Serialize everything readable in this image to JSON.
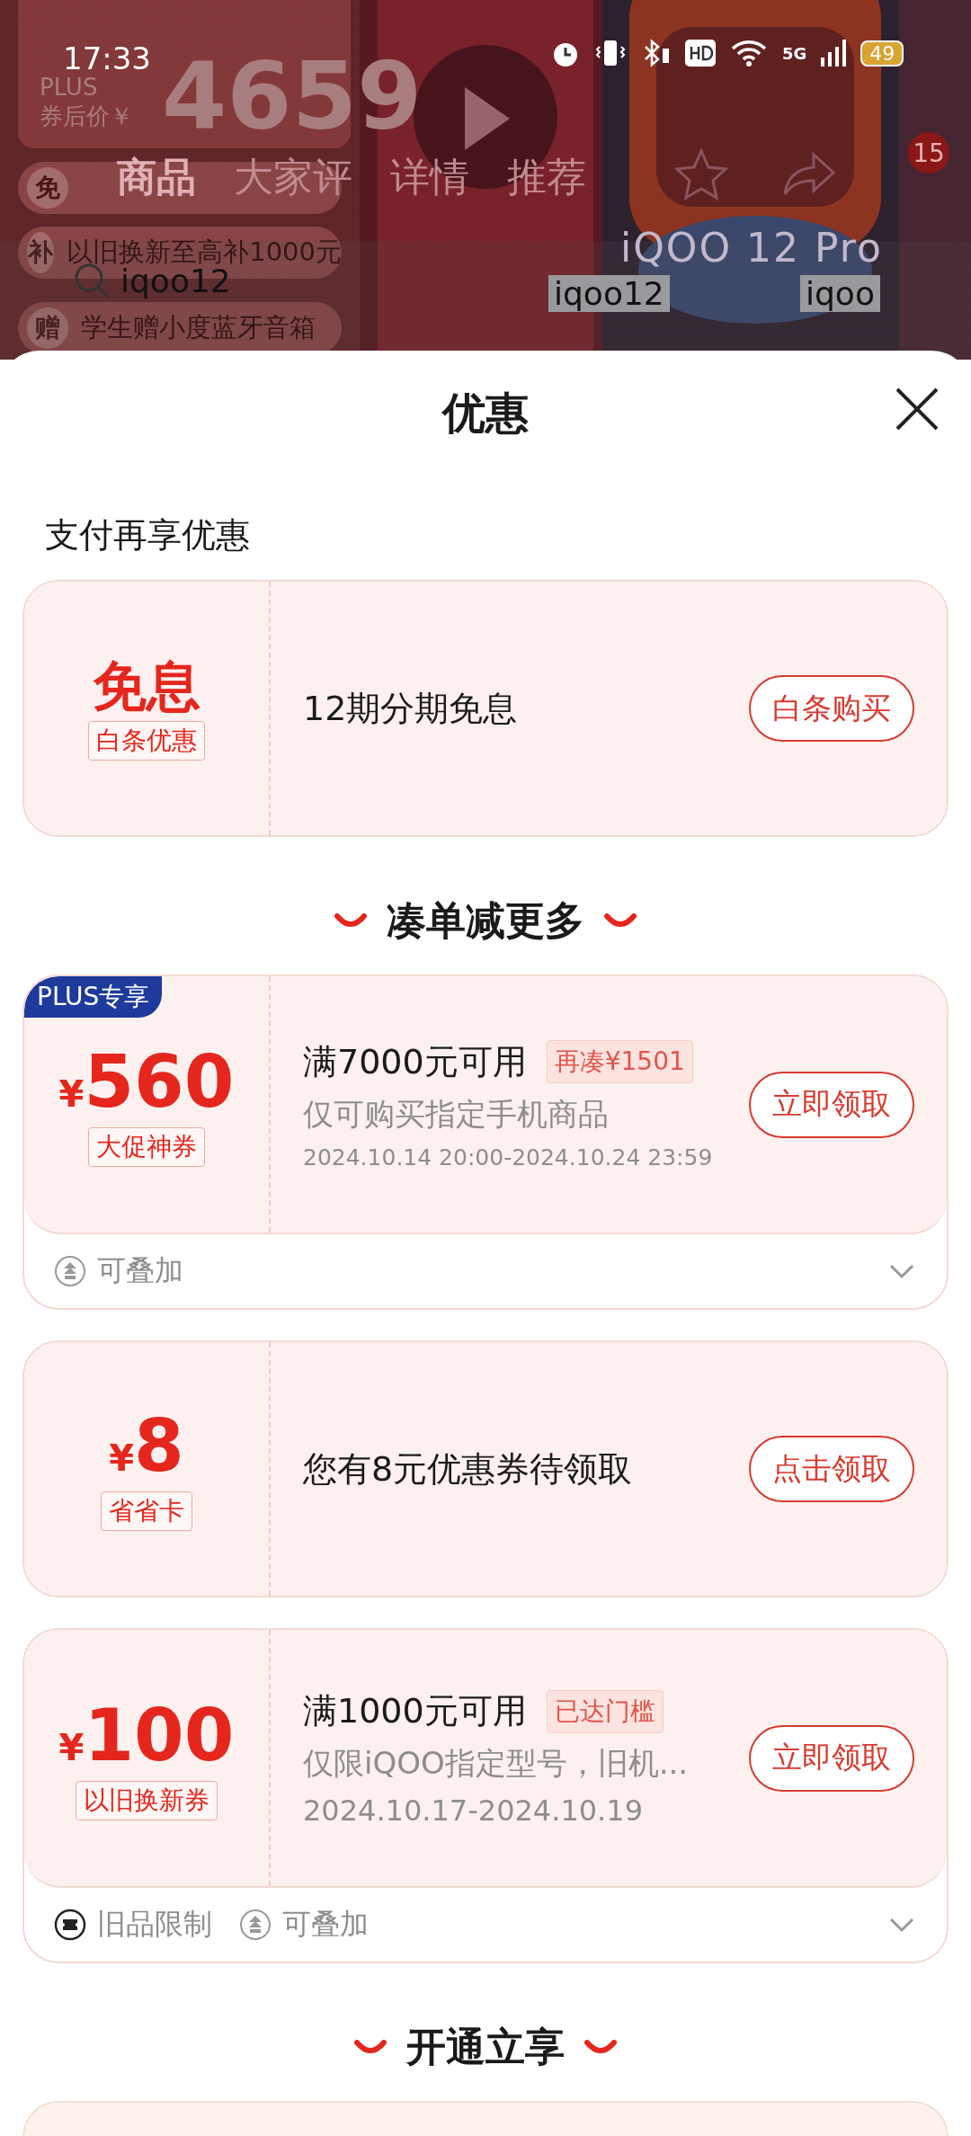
{
  "status_bar": {
    "time": "17:33",
    "network": "5G",
    "battery": "49"
  },
  "background": {
    "plus": "PLUS",
    "price_prefix": "券后价￥",
    "price": "4659",
    "promos": [
      {
        "tag": "免"
      },
      {
        "tag": "补",
        "text": "以旧换新至高补1000元"
      },
      {
        "tag": "赠",
        "text": "学生赠小度蓝牙音箱"
      }
    ],
    "tabs": [
      {
        "label": "商品",
        "selected": true
      },
      {
        "label": "大家评",
        "selected": false
      },
      {
        "label": "详情",
        "selected": false
      },
      {
        "label": "推荐",
        "selected": false
      }
    ],
    "cart_badge": "15",
    "product_name": "iQOO 12 Pro",
    "search": "iqoo12",
    "chips": [
      "iqoo12",
      "iqoo"
    ]
  },
  "sheet": {
    "title": "优惠",
    "sections": [
      {
        "kind": "plain",
        "heading": "支付再享优惠",
        "cards": [
          {
            "amount": "免息",
            "label": "白条优惠",
            "title": "12期分期免息",
            "button": "白条购买"
          }
        ]
      },
      {
        "kind": "ribbon",
        "heading": "凑单减更多",
        "cards": [
          {
            "badge": "PLUS专享",
            "currency": "¥",
            "amount": "560",
            "label": "大促神券",
            "title": "满7000元可用",
            "tag": "再凑¥1501",
            "desc": "仅可购买指定手机商品",
            "period": "2024.10.14 20:00-2024.10.24 23:59",
            "button": "立即领取",
            "footer": [
              {
                "kind": "stack",
                "text": "可叠加"
              }
            ]
          },
          {
            "currency": "¥",
            "amount": "8",
            "label": "省省卡",
            "title": "您有8元优惠券待领取",
            "button": "点击领取"
          },
          {
            "currency": "¥",
            "amount": "100",
            "label": "以旧换新券",
            "title": "满1000元可用",
            "tag": "已达门槛",
            "desc": "仅限iQOO指定型号，旧机...",
            "period": "2024.10.17-2024.10.19",
            "button": "立即领取",
            "footer": [
              {
                "kind": "ticket",
                "text": "旧品限制"
              },
              {
                "kind": "stack",
                "text": "可叠加"
              }
            ]
          }
        ]
      },
      {
        "kind": "ribbon",
        "heading": "开通立享",
        "cards": [
          {
            "kind": "partial"
          }
        ]
      }
    ]
  }
}
